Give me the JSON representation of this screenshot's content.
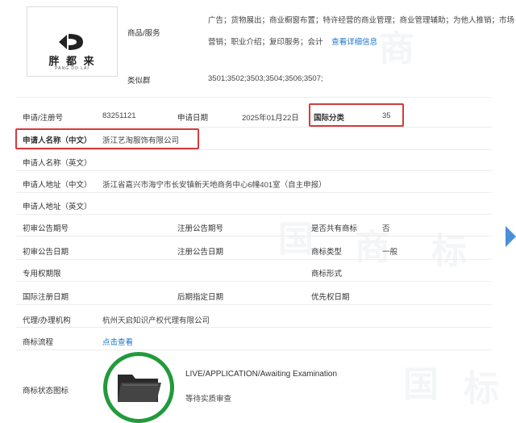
{
  "logo": {
    "text": "胖 都 来",
    "subtext": "PANG DO LAI"
  },
  "goods_services": {
    "label": "商品/服务",
    "line1": "广告；货物展出；商业橱窗布置；特许经营的商业管理；商业管理辅助；为他人推销；市场",
    "line2": "营销；职业介绍；复印服务；会计",
    "link": "查看详细信息"
  },
  "similar_group": {
    "label": "类似群",
    "value": "3501;3502;3503;3504;3506;3507;"
  },
  "fields": {
    "reg_no_label": "申请/注册号",
    "reg_no": "83251121",
    "apply_date_label": "申请日期",
    "apply_date": "2025年01月22日",
    "intl_class_label": "国际分类",
    "intl_class": "35",
    "applicant_cn_label": "申请人名称（中文）",
    "applicant_cn": "浙江艺淘服饰有限公司",
    "applicant_en_label": "申请人名称（英文）",
    "address_cn_label": "申请人地址（中文）",
    "address_cn": "浙江省嘉兴市海宁市长安镇新天地商务中心6幢401室（自主申报）",
    "address_en_label": "申请人地址（英文）",
    "prelim_no_label": "初审公告期号",
    "reg_pub_no_label": "注册公告期号",
    "shared_label": "是否共有商标",
    "shared": "否",
    "prelim_date_label": "初审公告日期",
    "reg_pub_date_label": "注册公告日期",
    "tm_type_label": "商标类型",
    "tm_type": "一般",
    "exclusive_label": "专用权期限",
    "tm_form_label": "商标形式",
    "intl_reg_date_label": "国际注册日期",
    "later_date_label": "后期指定日期",
    "priority_label": "优先权日期",
    "agent_label": "代理/办理机构",
    "agent": "杭州天启知识产权代理有限公司",
    "process_label": "商标流程",
    "process_link": "点击查看",
    "status_label": "商标状态图标",
    "status_en": "LIVE/APPLICATION/Awaiting Examination",
    "status_cn": "等待实质审查"
  },
  "colors": {
    "highlight": "#d63a3a",
    "link": "#1a73c9",
    "status_ring": "#229a3c",
    "arrow": "#4a90d9"
  },
  "icons": [
    "logo-mark-icon",
    "folder-icon",
    "next-arrow-icon"
  ],
  "watermark": "中国商标"
}
